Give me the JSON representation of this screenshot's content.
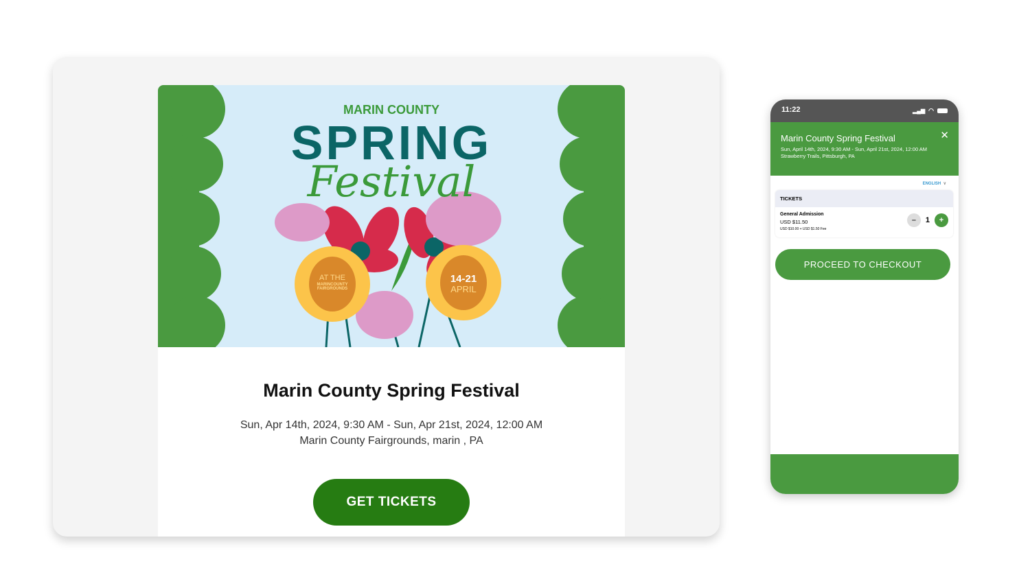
{
  "email": {
    "banner": {
      "county": "MARIN COUNTY",
      "spring": "SPRING",
      "festival": "Festival",
      "at_the": "AT THE",
      "venue_line1": "MARINCOUNTY",
      "venue_line2": "FAIRGROUNDS",
      "dates": "14-21",
      "month": "APRIL"
    },
    "title": "Marin County Spring Festival",
    "datetime": "Sun, Apr 14th, 2024, 9:30 AM - Sun, Apr 21st, 2024, 12:00 AM",
    "location": "Marin County Fairgrounds, marin , PA",
    "cta": "GET TICKETS"
  },
  "phone": {
    "time": "11:22",
    "status_icons": [
      "signal-icon",
      "wifi-icon",
      "battery-icon"
    ],
    "header": {
      "title": "Marin County Spring Festival",
      "datetime": "Sun, April 14th, 2024, 9:30 AM - Sun, April 21st, 2024, 12:00 AM",
      "location": "Strawberry Trails, Pittsburgh, PA",
      "close": "✕"
    },
    "language": "ENGLISH",
    "tickets": {
      "heading": "TICKETS",
      "items": [
        {
          "name": "General Admission",
          "price": "USD $11.50",
          "breakdown": "USD $10.00 + USD $1.50 Fee",
          "quantity": "1"
        }
      ]
    },
    "checkout": "PROCEED TO CHECKOUT"
  },
  "colors": {
    "brand_green": "#4a9a40",
    "cta_green": "#267c12",
    "banner_bg": "#d6ecf9"
  }
}
